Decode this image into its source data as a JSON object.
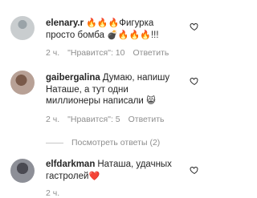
{
  "comments": [
    {
      "username": "elenary.r",
      "text": "Фигурка просто бомба",
      "time": "2 ч.",
      "likes": "\"Нравится\": 10",
      "reply": "Ответить"
    },
    {
      "username": "gaibergalina",
      "text": "Думаю, напишу Наташе, а тут одни миллионеры написали",
      "emoji": "😸",
      "time": "2 ч.",
      "likes": "\"Нравится\": 5",
      "reply": "Ответить",
      "view_replies": "Посмотреть ответы (2)"
    },
    {
      "username": "elfdarkman",
      "text": "Наташа, удачных гастролей",
      "time": "2 ч."
    }
  ],
  "icons": {
    "heart": "heart-outline-icon",
    "fire": "fire-emoji",
    "bomb": "bomb-emoji",
    "red_heart": "red-heart-emoji"
  }
}
